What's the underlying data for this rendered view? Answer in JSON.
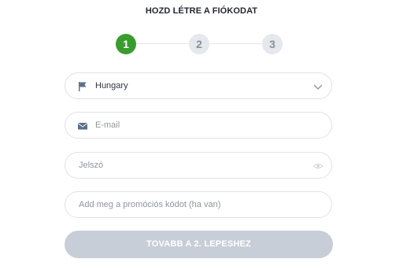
{
  "form": {
    "title": "HOZD LÉTRE A FIÓKODAT",
    "steps": [
      "1",
      "2",
      "3"
    ],
    "active_step": 1,
    "country": {
      "value": "Hungary",
      "icon": "flag-icon"
    },
    "email": {
      "placeholder": "E-mail",
      "icon": "envelope-icon"
    },
    "password": {
      "placeholder": "Jelszó",
      "toggle_icon": "eye-icon"
    },
    "promo": {
      "placeholder": "Add meg a promóciós kódot (ha van)"
    },
    "submit_label": "TOVABB A 2. LEPESHEZ"
  },
  "colors": {
    "active_step": "#3a9c2f",
    "inactive_step": "#e5e8ec",
    "submit_disabled": "#c7ced8",
    "icon": "#5b7088"
  }
}
